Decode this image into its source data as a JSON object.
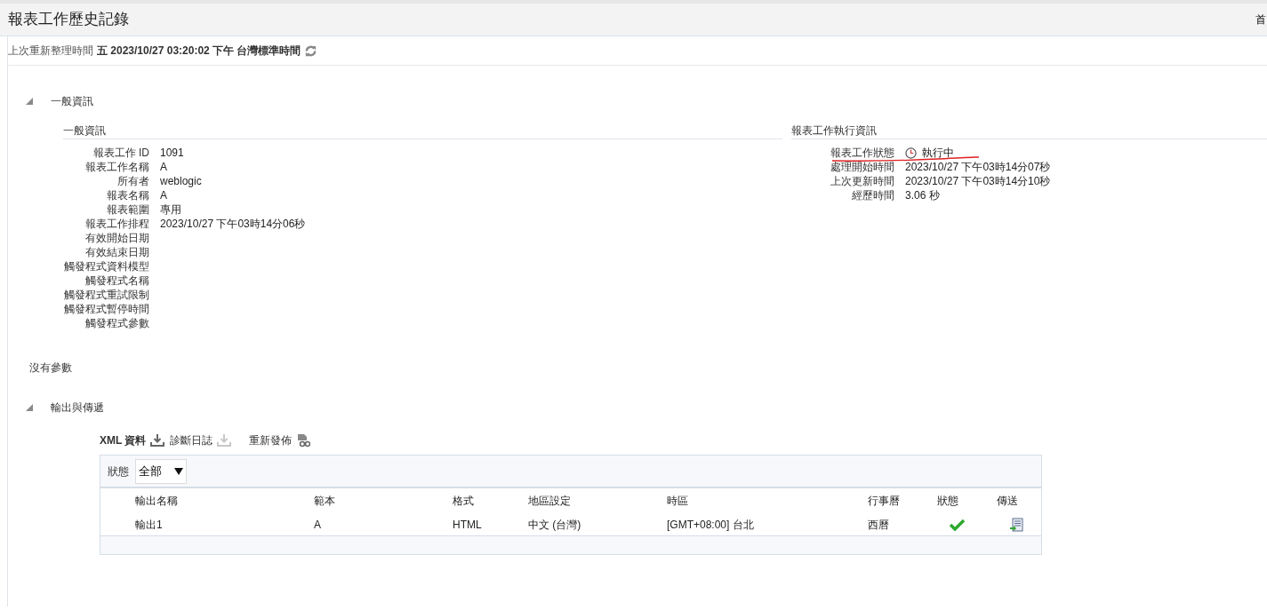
{
  "header": {
    "title": "報表工作歷史記錄",
    "corner_text": "首"
  },
  "refresh": {
    "label": "上次重新整理時間",
    "value": "五 2023/10/27 03:20:02 下午 台灣標準時間"
  },
  "general_section": {
    "title": "一般資訊",
    "expanded": true,
    "left": {
      "title": "一般資訊",
      "fields": [
        {
          "label": "報表工作 ID",
          "value": "1091"
        },
        {
          "label": "報表工作名稱",
          "value": "A"
        },
        {
          "label": "所有者",
          "value": "weblogic"
        },
        {
          "label": "報表名稱",
          "value": "A"
        },
        {
          "label": "報表範圍",
          "value": "專用"
        },
        {
          "label": "報表工作排程",
          "value": "2023/10/27 下午03時14分06秒"
        },
        {
          "label": "有效開始日期"
        },
        {
          "label": "有效結束日期"
        },
        {
          "label": "觸發程式資料模型"
        },
        {
          "label": "觸發程式名稱"
        },
        {
          "label": "觸發程式重試限制"
        },
        {
          "label": "觸發程式暫停時間"
        },
        {
          "label": "觸發程式參數"
        }
      ]
    },
    "right": {
      "title": "報表工作執行資訊",
      "fields": [
        {
          "label": "報表工作狀態",
          "value": "執行中",
          "kind": "status",
          "underlined": true
        },
        {
          "label": "處理開始時間",
          "value": "2023/10/27 下午03時14分07秒",
          "kind": "text"
        },
        {
          "label": "上次更新時間",
          "value": "2023/10/27 下午03時14分10秒",
          "kind": "text"
        },
        {
          "label": "經歷時間",
          "value": "3.06 秒",
          "kind": "text"
        }
      ]
    }
  },
  "no_params": "沒有參數",
  "output_section": {
    "title": "輸出與傳遞",
    "expanded": true,
    "toolbar": [
      {
        "label": "XML 資料",
        "kind": "download",
        "disabled": false
      },
      {
        "label": "診斷日誌",
        "kind": "download",
        "disabled": true
      },
      {
        "label": "重新發佈",
        "kind": "republish",
        "disabled": false
      }
    ],
    "filter": {
      "label": "狀態",
      "value": "全部"
    },
    "table": {
      "columns": [
        "輸出名稱",
        "範本",
        "格式",
        "地區設定",
        "時區",
        "行事曆",
        "狀態",
        "傳送"
      ],
      "rows": [
        {
          "cells": [
            "輸出1",
            "A",
            "HTML",
            "中文 (台灣)",
            "[GMT+08:00] 台北",
            "西曆"
          ],
          "succeeded": true
        }
      ]
    }
  }
}
